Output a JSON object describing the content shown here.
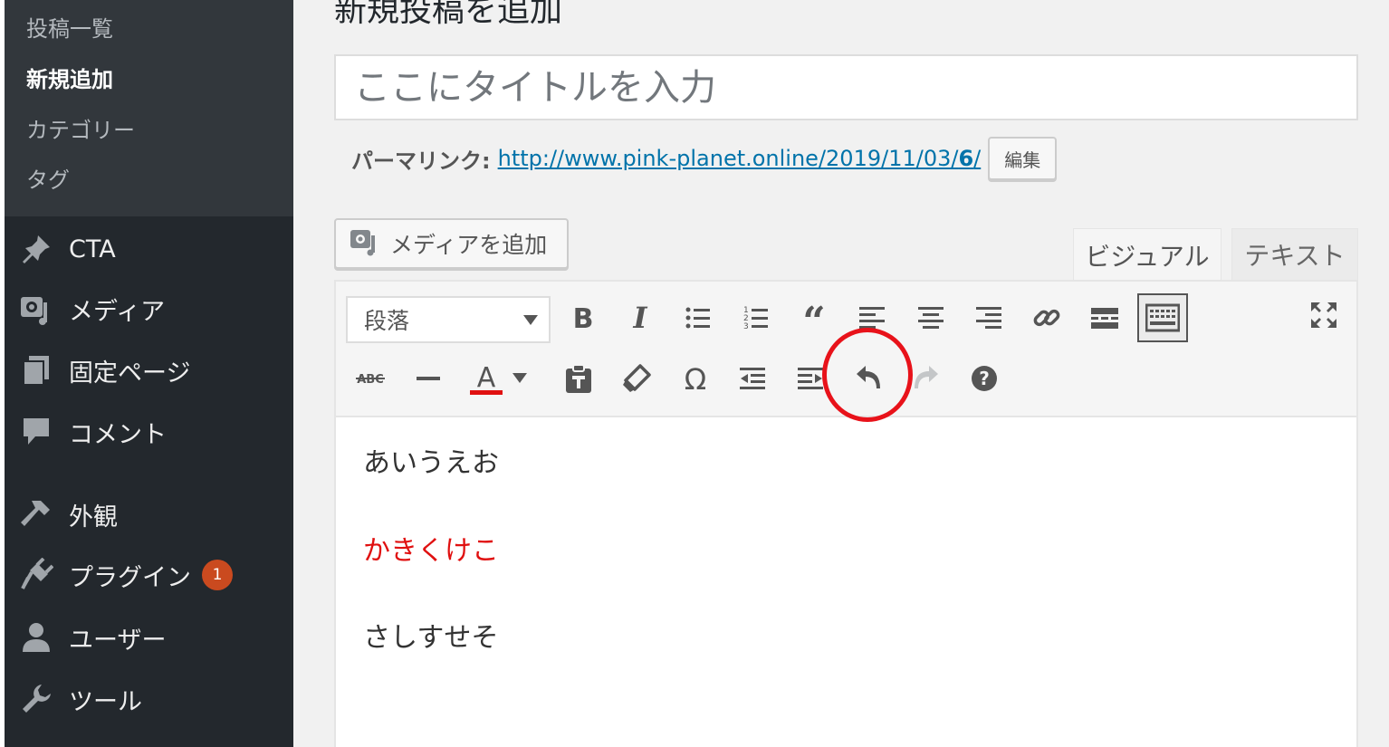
{
  "sidebar": {
    "submenu": [
      {
        "label": "投稿一覧",
        "current": false
      },
      {
        "label": "新規追加",
        "current": true
      },
      {
        "label": "カテゴリー",
        "current": false
      },
      {
        "label": "タグ",
        "current": false
      }
    ],
    "menu": [
      {
        "label": "CTA",
        "icon": "pin-icon"
      },
      {
        "label": "メディア",
        "icon": "media-icon"
      },
      {
        "label": "固定ページ",
        "icon": "pages-icon"
      },
      {
        "label": "コメント",
        "icon": "comment-icon"
      },
      {
        "label": "外観",
        "icon": "appearance-icon"
      },
      {
        "label": "プラグイン",
        "icon": "plugin-icon",
        "badge": "1"
      },
      {
        "label": "ユーザー",
        "icon": "user-icon"
      },
      {
        "label": "ツール",
        "icon": "wrench-icon"
      }
    ]
  },
  "main": {
    "page_title": "新規投稿を追加",
    "title_placeholder": "ここにタイトルを入力",
    "permalink_label": "パーマリンク:",
    "permalink_url_base": "http://www.pink-planet.online/2019/11/03/",
    "permalink_url_slug": "6",
    "permalink_url_end": "/",
    "edit_button": "編集",
    "add_media_button": "メディアを追加",
    "tabs": {
      "visual": "ビジュアル",
      "text": "テキスト"
    },
    "format_select_value": "段落",
    "toolbar_icons": [
      "bold-icon",
      "italic-icon",
      "bullet-list-icon",
      "numbered-list-icon",
      "blockquote-icon",
      "align-left-icon",
      "align-center-icon",
      "align-right-icon",
      "link-icon",
      "read-more-icon",
      "toolbar-toggle-icon",
      "fullscreen-icon",
      "strikethrough-icon",
      "horizontal-rule-icon",
      "text-color-icon",
      "paste-text-icon",
      "clear-formatting-icon",
      "special-character-icon",
      "outdent-icon",
      "indent-icon",
      "undo-icon",
      "redo-icon",
      "help-icon"
    ],
    "content": [
      {
        "text": "あいうえお",
        "color": "#333333"
      },
      {
        "text": "かきくけこ",
        "color": "#e01010"
      },
      {
        "text": "さしすせそ",
        "color": "#333333"
      }
    ],
    "text_color_underline": "#e01010",
    "highlight_color": "#e8121a"
  }
}
